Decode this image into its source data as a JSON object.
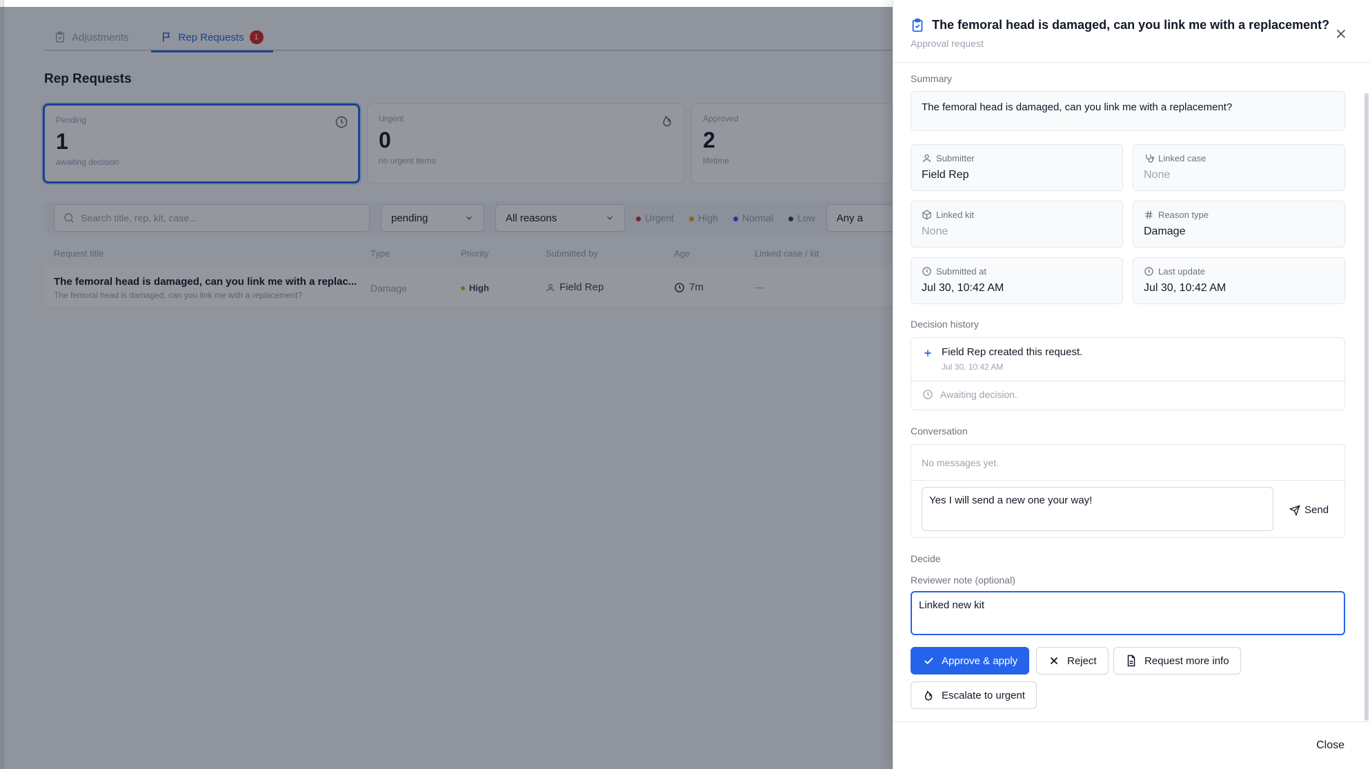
{
  "tabs": [
    {
      "label": "Adjustments",
      "icon": "clipboard-check-icon"
    },
    {
      "label": "Rep Requests",
      "icon": "flag-icon",
      "badge": "1"
    }
  ],
  "page_title": "Rep Requests",
  "stats": [
    {
      "label": "Pending",
      "value": "1",
      "sub": "awaiting decision",
      "icon": "clock-icon"
    },
    {
      "label": "Urgent",
      "value": "0",
      "sub": "no urgent items",
      "icon": "flame-icon"
    },
    {
      "label": "Approved",
      "value": "2",
      "sub": "lifetime"
    }
  ],
  "filters": {
    "search_placeholder": "Search title, rep, kit, case...",
    "status": "pending",
    "reason": "All reasons",
    "priorities": [
      "Urgent",
      "High",
      "Normal",
      "Low"
    ],
    "priority_colors": [
      "#dc2626",
      "#f59e0b",
      "#2563eb",
      "#6b7280"
    ],
    "any": "Any a"
  },
  "table": {
    "headers": [
      "Request title",
      "Type",
      "Priority",
      "Submitted by",
      "Age",
      "Linked case / kit"
    ],
    "row": {
      "title": "The femoral head is damaged, can you link me with a replac...",
      "subtitle": "The femoral head is damaged, can you link me with a replacement?",
      "type": "Damage",
      "priority": "High",
      "submitted_by": "Field Rep",
      "age": "7m",
      "linked": "—"
    }
  },
  "panel": {
    "title": "The femoral head is damaged, can you link me with a replacement?",
    "subtitle": "Approval request",
    "summary_label": "Summary",
    "summary": "The femoral head is damaged, can you link me with a replacement?",
    "fields": {
      "submitter": {
        "label": "Submitter",
        "value": "Field Rep"
      },
      "linked_case": {
        "label": "Linked case",
        "value": "None"
      },
      "linked_kit": {
        "label": "Linked kit",
        "value": "None"
      },
      "reason_type": {
        "label": "Reason type",
        "value": "Damage"
      },
      "submitted_at": {
        "label": "Submitted at",
        "value": "Jul 30, 10:42 AM"
      },
      "last_update": {
        "label": "Last update",
        "value": "Jul 30, 10:42 AM"
      }
    },
    "history_label": "Decision history",
    "history": {
      "actor": "Field Rep",
      "action": " created this request.",
      "time": "Jul 30, 10:42 AM",
      "awaiting": "Awaiting decision."
    },
    "conversation_label": "Conversation",
    "conversation_empty": "No messages yet.",
    "message_draft": "Yes I will send a new one your way!",
    "send_label": "Send",
    "decide_label": "Decide",
    "note_label": "Reviewer note (optional)",
    "note_value": "Linked new kit",
    "buttons": {
      "approve": "Approve & apply",
      "reject": "Reject",
      "request_info": "Request more info",
      "escalate": "Escalate to urgent"
    },
    "close_label": "Close",
    "accent": "#2563eb"
  }
}
